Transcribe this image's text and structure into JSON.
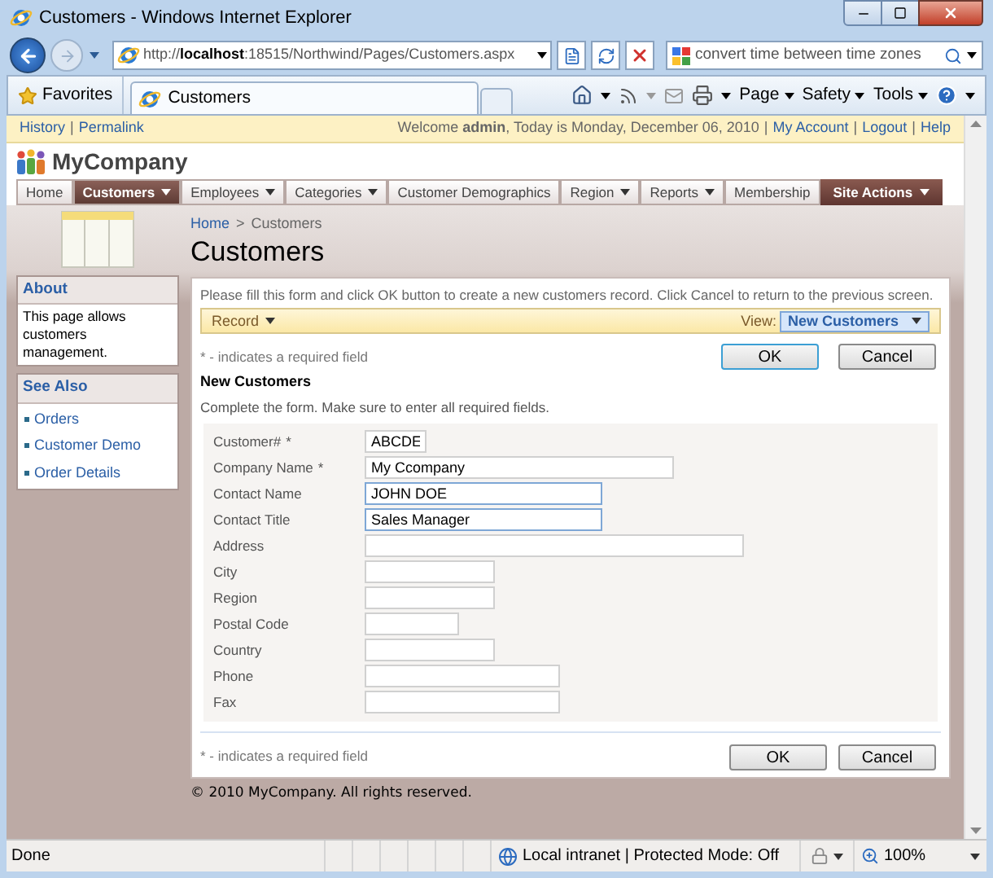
{
  "window": {
    "title": "Customers - Windows Internet Explorer"
  },
  "address_bar": {
    "value_prefix": "http://",
    "value_host": "localhost",
    "value_rest": ":18515/Northwind/Pages/Customers.aspx"
  },
  "search": {
    "value": "convert time between time zones"
  },
  "favorites": {
    "label": "Favorites"
  },
  "tabs": [
    {
      "label": "Customers",
      "selected": true
    }
  ],
  "command_bar": [
    "Page",
    "Safety",
    "Tools"
  ],
  "top_bar": {
    "left_items": [
      {
        "kind": "link",
        "text": "History"
      },
      {
        "kind": "separator",
        "text": "|"
      },
      {
        "kind": "link",
        "text": "Permalink"
      }
    ],
    "welcome": "Welcome **admin**, Today is Monday, December 06, 2010",
    "right_items": [
      {
        "kind": "separator",
        "text": "|"
      },
      {
        "kind": "link",
        "text": "My Account"
      },
      {
        "kind": "separator",
        "text": "|"
      },
      {
        "kind": "link",
        "text": "Logout"
      },
      {
        "kind": "separator",
        "text": "|"
      },
      {
        "kind": "link",
        "text": "Help"
      }
    ]
  },
  "logo": {
    "text": "MyCompany"
  },
  "menu": [
    {
      "label": "Home",
      "selected": false,
      "dropdown": false
    },
    {
      "label": "Customers",
      "selected": true,
      "dropdown": true
    },
    {
      "label": "Employees",
      "selected": false,
      "dropdown": true
    },
    {
      "label": "Categories",
      "selected": false,
      "dropdown": true
    },
    {
      "label": "Customer Demographics",
      "selected": false,
      "dropdown": false
    },
    {
      "label": "Region",
      "selected": false,
      "dropdown": true
    },
    {
      "label": "Reports",
      "selected": false,
      "dropdown": true
    },
    {
      "label": "Membership",
      "selected": false,
      "dropdown": false
    }
  ],
  "site_actions": {
    "label": "Site Actions"
  },
  "sidebar": [
    {
      "title": "About",
      "kind": "text",
      "text": "This page allows customers management."
    },
    {
      "title": "See Also",
      "kind": "links",
      "links": [
        "Orders",
        "Customer Demo",
        "Order Details"
      ]
    }
  ],
  "breadcrumb": [
    "Home",
    ">",
    "Customers"
  ],
  "heading": "Customers",
  "form": {
    "description": "Please fill this form and click OK button to create a new customers record. Click Cancel to return to the previous screen.",
    "action_bar": {
      "record": "Record",
      "view_label": "View:",
      "view_value": "New Customers"
    },
    "required_note": "* - indicates a required field",
    "buttons": [
      "OK",
      "Cancel"
    ],
    "section_title": "New Customers",
    "section_description": "Complete the form. Make sure to enter all required fields.",
    "fields": [
      {
        "label": "Customer#",
        "required_mark": "*",
        "value": "ABCDE",
        "focused": false
      },
      {
        "label": "Company Name",
        "required_mark": "*",
        "value": "My Ccompany",
        "focused": false
      },
      {
        "label": "Contact Name",
        "value": "JOHN DOE",
        "focused": true
      },
      {
        "label": "Contact Title",
        "value": "Sales Manager",
        "focused": true
      },
      {
        "label": "Address",
        "focused": false
      },
      {
        "label": "City",
        "focused": false
      },
      {
        "label": "Region",
        "focused": false
      },
      {
        "label": "Postal Code",
        "focused": false
      },
      {
        "label": "Country",
        "focused": false
      },
      {
        "label": "Phone",
        "focused": false
      },
      {
        "label": "Fax",
        "focused": false
      }
    ],
    "footer_note": "* - indicates a required field",
    "footer_buttons": [
      "OK",
      "Cancel"
    ]
  },
  "copyright": "© 2010 MyCompany. All rights reserved.",
  "status_bar": {
    "text": "Done",
    "zone": "Local intranet | Protected Mode: Off",
    "zoom": "100%"
  }
}
